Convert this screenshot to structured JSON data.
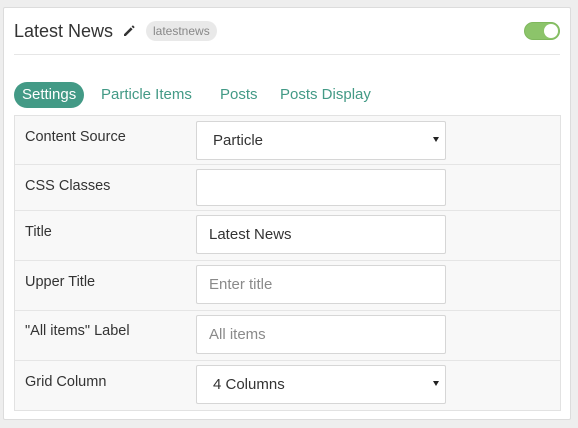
{
  "header": {
    "title": "Latest News",
    "badge": "latestnews",
    "toggle_enabled": true
  },
  "tabs": [
    {
      "label": "Settings",
      "active": true
    },
    {
      "label": "Particle Items",
      "active": false
    },
    {
      "label": "Posts",
      "active": false
    },
    {
      "label": "Posts Display",
      "active": false
    }
  ],
  "form": {
    "content_source": {
      "label": "Content Source",
      "value": "Particle"
    },
    "css_classes": {
      "label": "CSS Classes",
      "value": ""
    },
    "title": {
      "label": "Title",
      "value": "Latest News"
    },
    "upper_title": {
      "label": "Upper Title",
      "value": "",
      "placeholder": "Enter title"
    },
    "all_items_label": {
      "label": "\"All items\" Label",
      "value": "",
      "placeholder": "All items"
    },
    "grid_column": {
      "label": "Grid Column",
      "value": "4 Columns"
    }
  },
  "icons": {
    "edit": "pencil-icon",
    "dropdown": "caret-down-icon"
  },
  "colors": {
    "accent": "#439a86",
    "toggle_on": "#8cc46a"
  }
}
